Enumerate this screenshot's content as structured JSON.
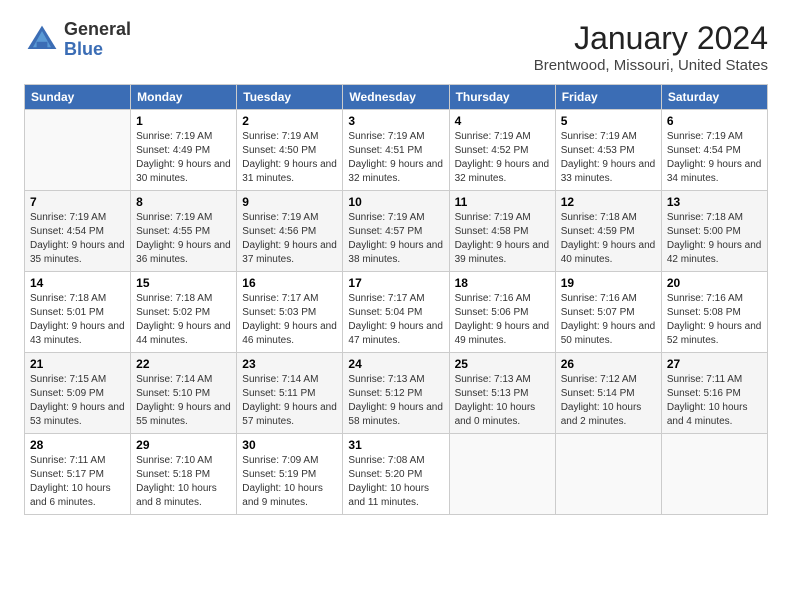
{
  "header": {
    "logo_general": "General",
    "logo_blue": "Blue",
    "month": "January 2024",
    "location": "Brentwood, Missouri, United States"
  },
  "columns": [
    "Sunday",
    "Monday",
    "Tuesday",
    "Wednesday",
    "Thursday",
    "Friday",
    "Saturday"
  ],
  "weeks": [
    [
      {
        "day": "",
        "sunrise": "",
        "sunset": "",
        "daylight": ""
      },
      {
        "day": "1",
        "sunrise": "Sunrise: 7:19 AM",
        "sunset": "Sunset: 4:49 PM",
        "daylight": "Daylight: 9 hours and 30 minutes."
      },
      {
        "day": "2",
        "sunrise": "Sunrise: 7:19 AM",
        "sunset": "Sunset: 4:50 PM",
        "daylight": "Daylight: 9 hours and 31 minutes."
      },
      {
        "day": "3",
        "sunrise": "Sunrise: 7:19 AM",
        "sunset": "Sunset: 4:51 PM",
        "daylight": "Daylight: 9 hours and 32 minutes."
      },
      {
        "day": "4",
        "sunrise": "Sunrise: 7:19 AM",
        "sunset": "Sunset: 4:52 PM",
        "daylight": "Daylight: 9 hours and 32 minutes."
      },
      {
        "day": "5",
        "sunrise": "Sunrise: 7:19 AM",
        "sunset": "Sunset: 4:53 PM",
        "daylight": "Daylight: 9 hours and 33 minutes."
      },
      {
        "day": "6",
        "sunrise": "Sunrise: 7:19 AM",
        "sunset": "Sunset: 4:54 PM",
        "daylight": "Daylight: 9 hours and 34 minutes."
      }
    ],
    [
      {
        "day": "7",
        "sunrise": "Sunrise: 7:19 AM",
        "sunset": "Sunset: 4:54 PM",
        "daylight": "Daylight: 9 hours and 35 minutes."
      },
      {
        "day": "8",
        "sunrise": "Sunrise: 7:19 AM",
        "sunset": "Sunset: 4:55 PM",
        "daylight": "Daylight: 9 hours and 36 minutes."
      },
      {
        "day": "9",
        "sunrise": "Sunrise: 7:19 AM",
        "sunset": "Sunset: 4:56 PM",
        "daylight": "Daylight: 9 hours and 37 minutes."
      },
      {
        "day": "10",
        "sunrise": "Sunrise: 7:19 AM",
        "sunset": "Sunset: 4:57 PM",
        "daylight": "Daylight: 9 hours and 38 minutes."
      },
      {
        "day": "11",
        "sunrise": "Sunrise: 7:19 AM",
        "sunset": "Sunset: 4:58 PM",
        "daylight": "Daylight: 9 hours and 39 minutes."
      },
      {
        "day": "12",
        "sunrise": "Sunrise: 7:18 AM",
        "sunset": "Sunset: 4:59 PM",
        "daylight": "Daylight: 9 hours and 40 minutes."
      },
      {
        "day": "13",
        "sunrise": "Sunrise: 7:18 AM",
        "sunset": "Sunset: 5:00 PM",
        "daylight": "Daylight: 9 hours and 42 minutes."
      }
    ],
    [
      {
        "day": "14",
        "sunrise": "Sunrise: 7:18 AM",
        "sunset": "Sunset: 5:01 PM",
        "daylight": "Daylight: 9 hours and 43 minutes."
      },
      {
        "day": "15",
        "sunrise": "Sunrise: 7:18 AM",
        "sunset": "Sunset: 5:02 PM",
        "daylight": "Daylight: 9 hours and 44 minutes."
      },
      {
        "day": "16",
        "sunrise": "Sunrise: 7:17 AM",
        "sunset": "Sunset: 5:03 PM",
        "daylight": "Daylight: 9 hours and 46 minutes."
      },
      {
        "day": "17",
        "sunrise": "Sunrise: 7:17 AM",
        "sunset": "Sunset: 5:04 PM",
        "daylight": "Daylight: 9 hours and 47 minutes."
      },
      {
        "day": "18",
        "sunrise": "Sunrise: 7:16 AM",
        "sunset": "Sunset: 5:06 PM",
        "daylight": "Daylight: 9 hours and 49 minutes."
      },
      {
        "day": "19",
        "sunrise": "Sunrise: 7:16 AM",
        "sunset": "Sunset: 5:07 PM",
        "daylight": "Daylight: 9 hours and 50 minutes."
      },
      {
        "day": "20",
        "sunrise": "Sunrise: 7:16 AM",
        "sunset": "Sunset: 5:08 PM",
        "daylight": "Daylight: 9 hours and 52 minutes."
      }
    ],
    [
      {
        "day": "21",
        "sunrise": "Sunrise: 7:15 AM",
        "sunset": "Sunset: 5:09 PM",
        "daylight": "Daylight: 9 hours and 53 minutes."
      },
      {
        "day": "22",
        "sunrise": "Sunrise: 7:14 AM",
        "sunset": "Sunset: 5:10 PM",
        "daylight": "Daylight: 9 hours and 55 minutes."
      },
      {
        "day": "23",
        "sunrise": "Sunrise: 7:14 AM",
        "sunset": "Sunset: 5:11 PM",
        "daylight": "Daylight: 9 hours and 57 minutes."
      },
      {
        "day": "24",
        "sunrise": "Sunrise: 7:13 AM",
        "sunset": "Sunset: 5:12 PM",
        "daylight": "Daylight: 9 hours and 58 minutes."
      },
      {
        "day": "25",
        "sunrise": "Sunrise: 7:13 AM",
        "sunset": "Sunset: 5:13 PM",
        "daylight": "Daylight: 10 hours and 0 minutes."
      },
      {
        "day": "26",
        "sunrise": "Sunrise: 7:12 AM",
        "sunset": "Sunset: 5:14 PM",
        "daylight": "Daylight: 10 hours and 2 minutes."
      },
      {
        "day": "27",
        "sunrise": "Sunrise: 7:11 AM",
        "sunset": "Sunset: 5:16 PM",
        "daylight": "Daylight: 10 hours and 4 minutes."
      }
    ],
    [
      {
        "day": "28",
        "sunrise": "Sunrise: 7:11 AM",
        "sunset": "Sunset: 5:17 PM",
        "daylight": "Daylight: 10 hours and 6 minutes."
      },
      {
        "day": "29",
        "sunrise": "Sunrise: 7:10 AM",
        "sunset": "Sunset: 5:18 PM",
        "daylight": "Daylight: 10 hours and 8 minutes."
      },
      {
        "day": "30",
        "sunrise": "Sunrise: 7:09 AM",
        "sunset": "Sunset: 5:19 PM",
        "daylight": "Daylight: 10 hours and 9 minutes."
      },
      {
        "day": "31",
        "sunrise": "Sunrise: 7:08 AM",
        "sunset": "Sunset: 5:20 PM",
        "daylight": "Daylight: 10 hours and 11 minutes."
      },
      {
        "day": "",
        "sunrise": "",
        "sunset": "",
        "daylight": ""
      },
      {
        "day": "",
        "sunrise": "",
        "sunset": "",
        "daylight": ""
      },
      {
        "day": "",
        "sunrise": "",
        "sunset": "",
        "daylight": ""
      }
    ]
  ]
}
